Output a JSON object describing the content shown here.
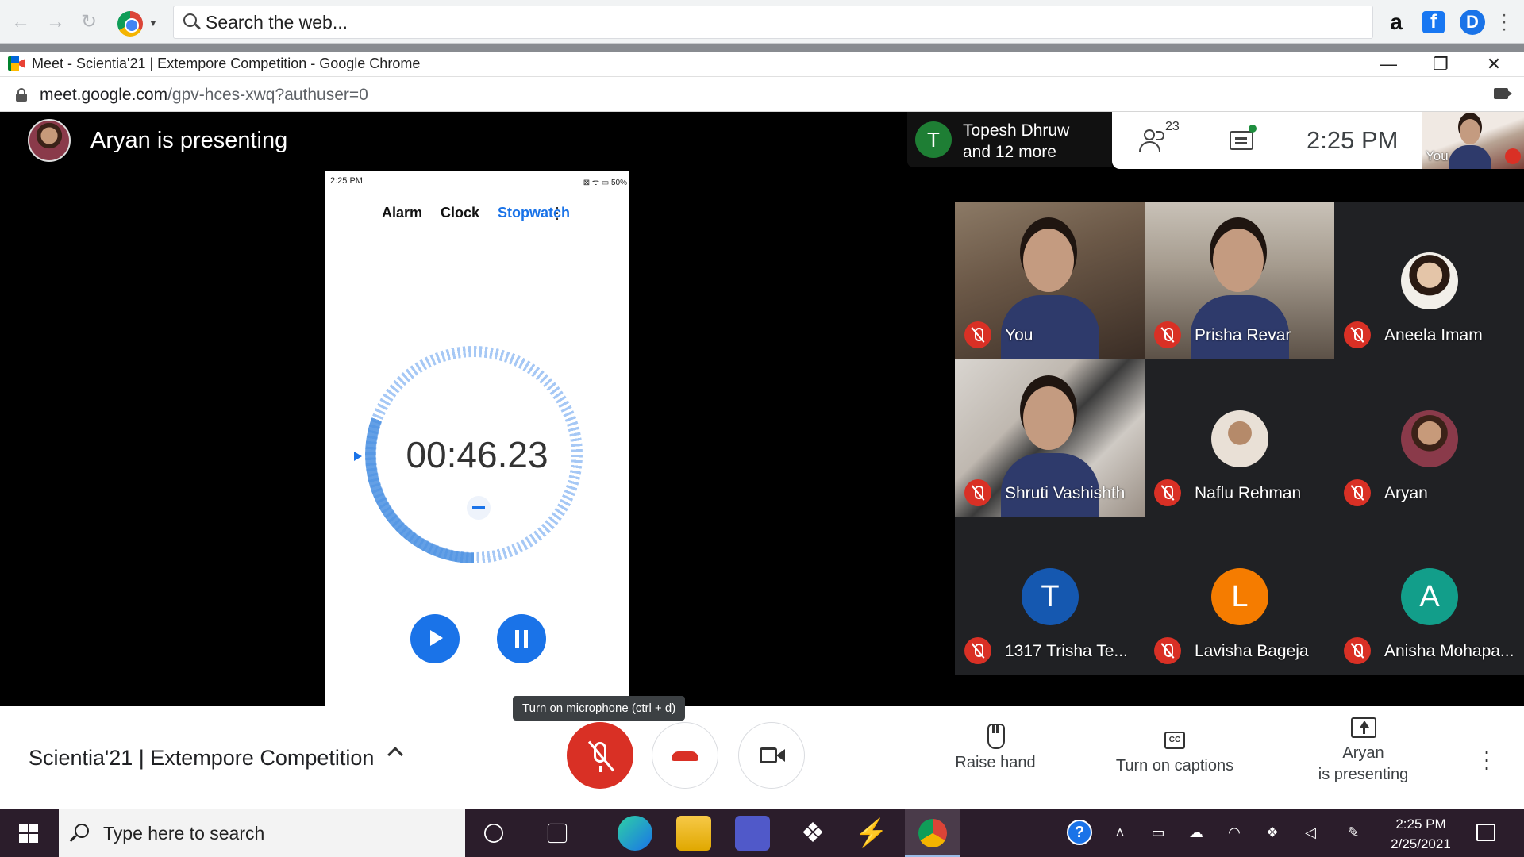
{
  "browser": {
    "search_placeholder": "Search the web...",
    "window_title": "Meet - Scientia'21 | Extempore Competition - Google Chrome",
    "url_host": "meet.google.com",
    "url_path": "/gpv-hces-xwq?authuser=0",
    "extensions": {
      "amazon": "a",
      "facebook": "f",
      "profile": "D"
    },
    "window_controls": {
      "minimize": "—",
      "maximize": "❐",
      "close": "✕"
    }
  },
  "meet": {
    "presenter_label": "Aryan is presenting",
    "participants_chip": {
      "avatar_letter": "T",
      "line1": "Topesh Dhruw",
      "line2": "and 12 more"
    },
    "people_count": "23",
    "clock": "2:25 PM",
    "self_preview_label": "You",
    "phone": {
      "status_time": "2:25 PM",
      "status_right": "⊠ ᯤ ▭ 50%",
      "tabs": [
        "Alarm",
        "Clock",
        "Stopwatch"
      ],
      "menu": "⋮",
      "stopwatch_value": "00:46.23"
    },
    "tiles": [
      {
        "name": "You",
        "kind": "video"
      },
      {
        "name": "Prisha Revar",
        "kind": "video"
      },
      {
        "name": "Aneela Imam",
        "kind": "photo"
      },
      {
        "name": "Shruti Vashishth",
        "kind": "video"
      },
      {
        "name": "Naflu Rehman",
        "kind": "photo"
      },
      {
        "name": "Aryan",
        "kind": "photo"
      },
      {
        "name": "1317 Trisha Te...",
        "kind": "letter",
        "letter": "T",
        "color": "#1558b0"
      },
      {
        "name": "Lavisha Bageja",
        "kind": "letter",
        "letter": "L",
        "color": "#f57c00"
      },
      {
        "name": "Anisha Mohapa...",
        "kind": "letter",
        "letter": "A",
        "color": "#129e8a"
      }
    ],
    "bottom_bar": {
      "meeting_title": "Scientia'21 | Extempore Competition",
      "tooltip": "Turn on microphone (ctrl + d)",
      "raise_hand": "Raise hand",
      "captions": "Turn on captions",
      "captions_icon": "CC",
      "presenting_line1": "Aryan",
      "presenting_line2": "is presenting",
      "more": "⋮"
    }
  },
  "taskbar": {
    "search_placeholder": "Type here to search",
    "time": "2:25 PM",
    "date": "2/25/2021",
    "help_icon": "?"
  },
  "colors": {
    "accent_blue": "#1a73e8",
    "mute_red": "#d93025",
    "stage_bg": "#000000",
    "grid_bg": "#202124"
  }
}
